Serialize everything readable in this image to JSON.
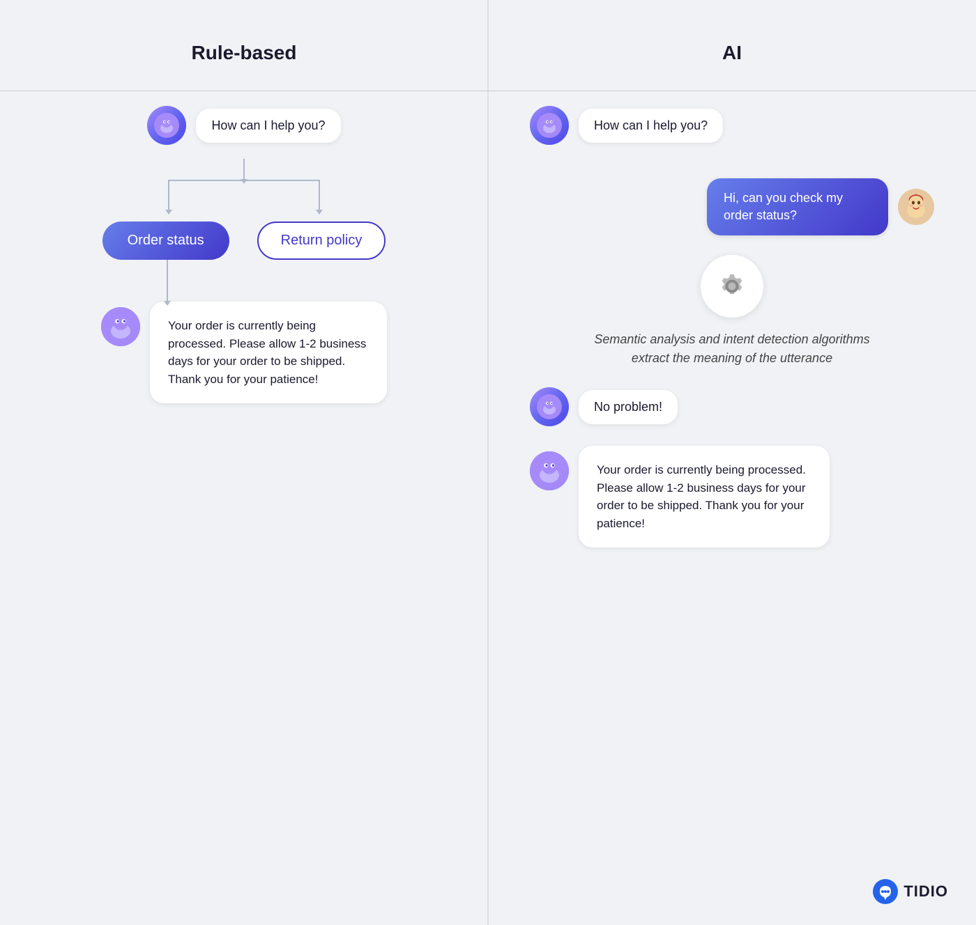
{
  "left": {
    "title": "Rule-based",
    "bot_greeting": "How can I help you?",
    "option_filled": "Order status",
    "option_outline": "Return policy",
    "response_text": "Your order is currently being processed. Please allow 1-2 business days for your order to be shipped. Thank you for your patience!"
  },
  "right": {
    "title": "AI",
    "bot_greeting": "How can I help you?",
    "user_message": "Hi, can you check my order status?",
    "processing_text": "Semantic analysis and intent detection algorithms extract the meaning of the utterance",
    "bot_no_problem": "No problem!",
    "response_text": "Your order is currently being processed. Please allow 1-2 business days for your order to be shipped. Thank you for your patience!"
  },
  "tidio": {
    "label": "TIDIO"
  },
  "colors": {
    "accent": "#4338ca",
    "gradient_start": "#667eea",
    "gradient_end": "#4338ca",
    "bg": "#f0f2f5"
  }
}
